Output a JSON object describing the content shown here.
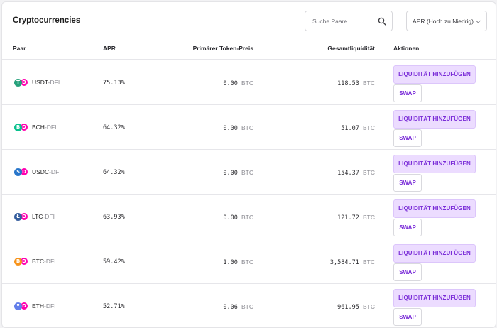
{
  "header": {
    "title": "Cryptocurrencies",
    "search_placeholder": "Suche Paare",
    "sort_value": "APR (Hoch zu Niedrig)"
  },
  "columns": {
    "pair": "Paar",
    "apr": "APR",
    "price": "Primärer Token-Preis",
    "liquidity": "Gesamtliquidität",
    "actions": "Aktionen"
  },
  "actions": {
    "add_liquidity": "LIQUIDITÄT HINZUFÜGEN",
    "swap": "SWAP"
  },
  "unit": "BTC",
  "rows": [
    {
      "token": "USDT",
      "quote": "-DFI",
      "apr": "75.13%",
      "price": "0.00",
      "liquidity": "118.53",
      "coin_color": "#26a17b",
      "coin_glyph": "T"
    },
    {
      "token": "BCH",
      "quote": "-DFI",
      "apr": "64.32%",
      "price": "0.00",
      "liquidity": "51.07",
      "coin_color": "#0ac18e",
      "coin_glyph": "B"
    },
    {
      "token": "USDC",
      "quote": "-DFI",
      "apr": "64.32%",
      "price": "0.00",
      "liquidity": "154.37",
      "coin_color": "#2775ca",
      "coin_glyph": "$"
    },
    {
      "token": "LTC",
      "quote": "-DFI",
      "apr": "63.93%",
      "price": "0.00",
      "liquidity": "121.72",
      "coin_color": "#345d9d",
      "coin_glyph": "Ł"
    },
    {
      "token": "BTC",
      "quote": "-DFI",
      "apr": "59.42%",
      "price": "1.00",
      "liquidity": "3,584.71",
      "coin_color": "#f7931a",
      "coin_glyph": "B"
    },
    {
      "token": "ETH",
      "quote": "-DFI",
      "apr": "52.71%",
      "price": "0.06",
      "liquidity": "961.95",
      "coin_color": "#627eea",
      "coin_glyph": "Ξ"
    }
  ]
}
